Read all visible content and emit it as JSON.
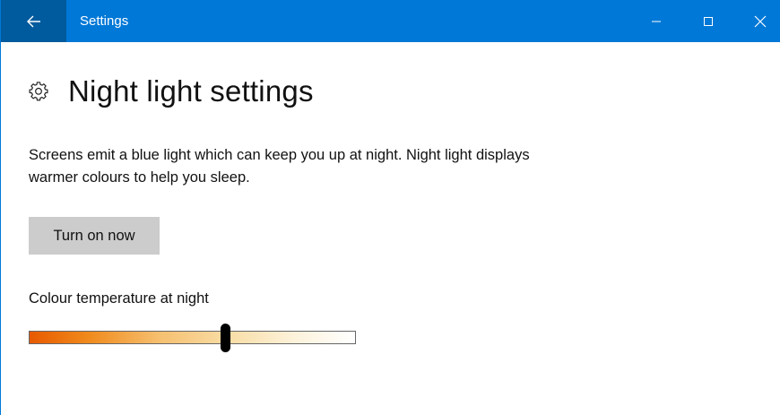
{
  "titlebar": {
    "title": "Settings",
    "back_icon": "back-arrow-icon",
    "minimize_icon": "minimize-icon",
    "maximize_icon": "maximize-icon",
    "close_icon": "close-icon",
    "accent_color": "#0078d7",
    "back_button_color": "#005a9e"
  },
  "page": {
    "icon": "gear-icon",
    "title": "Night light settings",
    "description": "Screens emit a blue light which can keep you up at night. Night light displays warmer colours to help you sleep.",
    "turn_on_label": "Turn on now",
    "colour_temperature_label": "Colour temperature at night",
    "colour_temperature_level": 0.6
  }
}
